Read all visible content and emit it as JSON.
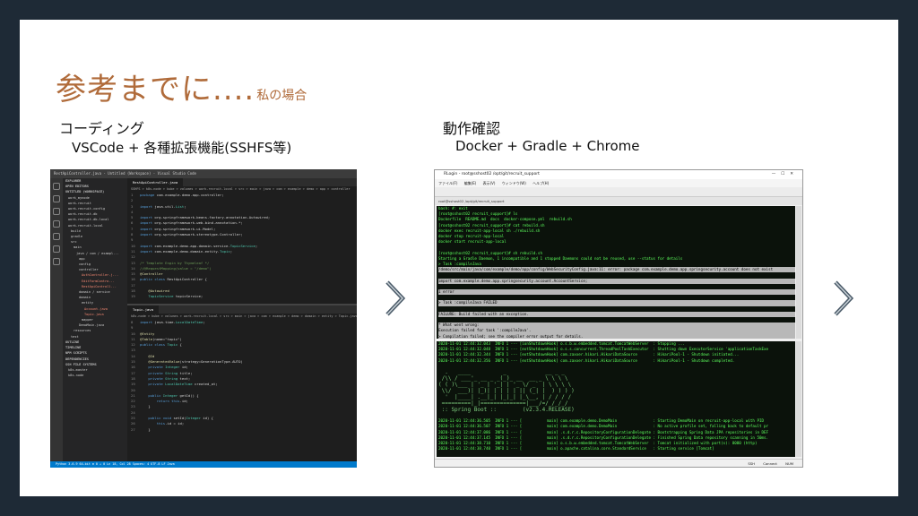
{
  "title": {
    "main": "参考までに....",
    "sub": "私の場合"
  },
  "left": {
    "label": "コーディング",
    "sublabel": "VSCode + 各種拡張機能(SSHFS等)"
  },
  "right": {
    "label": "動作確認",
    "sublabel": "Docker + Gradle + Chrome"
  },
  "colors": {
    "title": "#b06b3a",
    "frame": "#1e2a36",
    "vscode_status": "#007acc"
  },
  "vscode": {
    "window_title": "RestApiController.java - Untitled (Workspace) - Visual Studio Code",
    "tab_top": "RestApiController.java",
    "tab_bottom": "Topic.java",
    "breadcrumb_top": "SSHFS > k8s-node > kube > volumes > work-recruit-local > src > main > java > com > example > demo > app > controller",
    "breadcrumb_bottom": "k8s-node > kube > volumes > work-recruit-local > src > main > java > com > example > demo > domain > entity > Topic.java",
    "sidebar": [
      "EXPLORER",
      "OPEN EDITORS",
      "UNTITLED (WORKSPACE)",
      "work_mynode",
      "work-recruit",
      "work-recruit-config",
      "work-recruit-db",
      "work-recruit-db-local",
      "work-recruit-local",
      "build",
      "gradle",
      "src",
      "main",
      "java / com / exampl...",
      "app",
      "config",
      "controller",
      "AuthController.j...",
      "EditFormContro...",
      "RestApiControll...",
      "domain / service",
      "domain",
      "entity",
      "Account.java",
      "Topic.java",
      "mapper",
      "DemoMain.java",
      "resources",
      "test",
      "OUTLINE",
      "TIMELINE",
      "NPM SCRIPTS",
      "DEPENDENCIES",
      "SSH FILE SYSTEMS",
      "k8s-master",
      "k8s-node"
    ],
    "code_top": [
      "package com.example.demo.app.controller;",
      "",
      "import java.util.List;",
      "",
      "import org.springframework.beans.factory.annotation.Autowired;",
      "import org.springframework.web.bind.annotation.*;",
      "import org.springframework.ui.Model;",
      "import org.springframework.stereotype.Controller;",
      "",
      "import com.example.demo.app.domain.service.TopicService;",
      "import com.example.demo.domain.entity.Topic;",
      "",
      "/* Template Engin by Thymeleaf */",
      "//@RequestMapping(value = \"/demo\")",
      "@Controller",
      "public class RestApiController {",
      "",
      "    @Autowired",
      "    TopicService topicService;"
    ],
    "code_bottom": [
      "import java.time.LocalDateTime;",
      "",
      "@Entity",
      "@Table(name=\"topic\")",
      "public class Topic {",
      "",
      "    @Id",
      "    @GeneratedValue(strategy=GenerationType.AUTO)",
      "    private Integer id;",
      "    private String title;",
      "    private String text;",
      "    private LocalDateTime created_at;",
      "",
      "    public Integer getId() {",
      "        return this.id;",
      "    }",
      "",
      "    public void setId(Integer id) {",
      "        this.id = id;",
      "    }"
    ],
    "status": "Python 3.6.9 64-bit   ⊗ 0 ⚠ 0          Ln 18, Col 28   Spaces: 4   UTF-8   LF   Java"
  },
  "terminal": {
    "window_title": "RLogin - root@sshost02 /opt/git/recruit_support",
    "menu": "ファイル(F) 編集(E) 表示(V) ウィンドウ(W) ヘルプ(H)",
    "tab": "root@sshost02 /opt/git/recruit_support",
    "pane_top": [
      "bash: #: exit",
      "[root@sshost02 recruit_support]# ls",
      "Dockerfile  README.md  docs  docker-compose.yml  rebuild.sh",
      "[root@sshost02 recruit_support]# cat rebuild.sh",
      "docker exec recruit-app-local sh ./rebuild.sh",
      "docker stop recruit-app-local",
      "docker start recruit-app-local",
      "",
      "[root@sshost02 recruit_support]# sh rebuild.sh",
      "Starting a Gradle Daemon, 1 incompatible and 1 stopped Daemons could not be reused, use --status for details",
      "> Task :compileJava",
      "/demo/src/main/java/com/example/demo/app/config/WebSecurityConfig.java:11: error: package com.example.demo.app.springsecurity.account does not exist",
      "",
      "import com.example.demo.app.springsecurity.account.AccountService;",
      "",
      "1 error",
      "",
      "> Task :compileJava FAILED",
      "",
      "FAILURE: Build failed with an exception.",
      "",
      "* What went wrong:",
      "Execution failed for task ':compileJava'.",
      "> Compilation failed; see the compiler error output for details."
    ],
    "pane_bottom": [
      "2020-11-01 12:44:32.043  INFO 1 --- [ionShutdownHook] o.s.b.w.embedded.tomcat.TomcatWebServer  : Stopping ...",
      "2020-11-01 12:44:32.048  INFO 1 --- [extShutdownHook] o.s.s.concurrent.ThreadPoolTaskExecutor  : Shutting down ExecutorService 'applicationTaskExe",
      "2020-11-01 12:44:32.344  INFO 1 --- [extShutdownHook] com.zaxxer.hikari.HikariDataSource       : HikariPool-1 - Shutdown initiated...",
      "2020-11-01 12:44:32.356  INFO 1 --- [extShutdownHook] com.zaxxer.hikari.HikariDataSource       : HikariPool-1 - Shutdown completed.",
      "",
      "  .   ____          _            __ _ _",
      " /\\\\ / ___'_ __ _ _(_)_ __  __ _ \\ \\ \\ \\",
      "( ( )\\___ | '_ | '_| | '_ \\/ _` | \\ \\ \\ \\",
      " \\\\/  ___)| |_)| | | | | || (_| |  ) ) ) )",
      "  '  |____| .__|_| |_|_| |_\\__, | / / / /",
      " =========|_|==============|___/=/_/_/_/",
      " :: Spring Boot ::        (v2.3.4.RELEASE)",
      "",
      "2020-11-01 12:44:36.505  INFO 1 --- [           main] com.example.demo.DemoMain                : Starting DemoMain on recruit-app-local with PID",
      "2020-11-01 12:44:36.507  INFO 1 --- [           main] com.example.demo.DemoMain                : No active profile set, falling back to default pr",
      "2020-11-01 12:44:37.086  INFO 1 --- [           main] .s.d.r.c.RepositoryConfigurationDelegate : Bootstrapping Spring Data JPA repositories in DEF",
      "2020-11-01 12:44:37.145  INFO 1 --- [           main] .s.d.r.c.RepositoryConfigurationDelegate : Finished Spring Data repository scanning in 50ms.",
      "2020-11-01 12:44:38.710  INFO 1 --- [           main] o.s.b.w.embedded.tomcat.TomcatWebServer  : Tomcat initialized with port(s): 8080 (http)",
      "2020-11-01 12:44:38.740  INFO 1 --- [           main] o.apache.catalina.core.StandardService   : Starting service [Tomcat]"
    ],
    "status": "SSH   Connect   NUM"
  }
}
